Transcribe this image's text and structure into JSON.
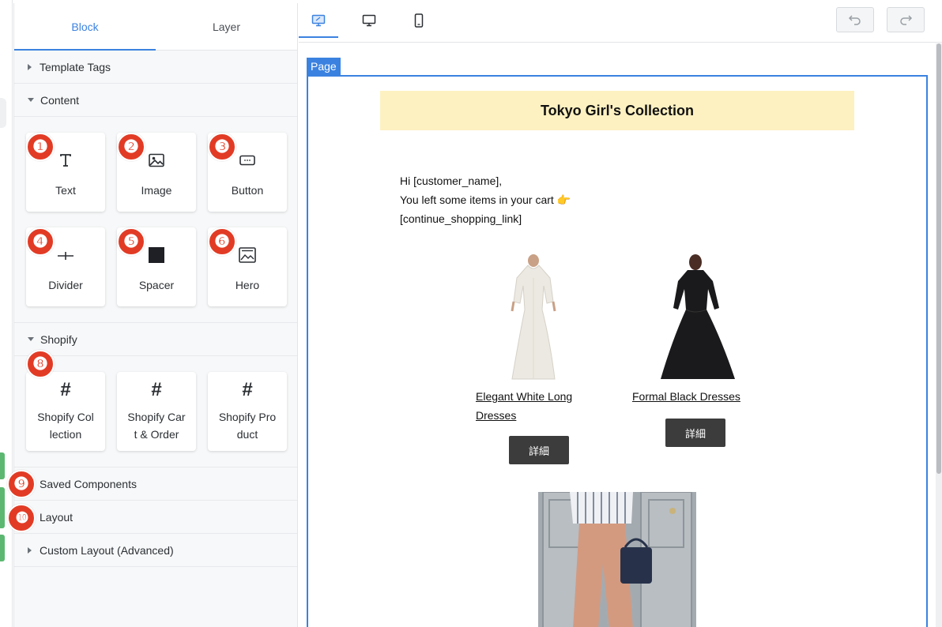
{
  "panel": {
    "tabs": [
      {
        "label": "Block",
        "active": true
      },
      {
        "label": "Layer",
        "active": false
      }
    ],
    "sections": {
      "template_tags": "Template Tags",
      "content": "Content",
      "shopify": "Shopify",
      "saved": "Saved Components",
      "layout": "Layout",
      "custom_layout": "Custom Layout (Advanced)"
    },
    "content_blocks": [
      {
        "label": "Text",
        "icon": "text-icon",
        "badge": "❶"
      },
      {
        "label": "Image",
        "icon": "image-icon",
        "badge": "❷"
      },
      {
        "label": "Button",
        "icon": "button-icon",
        "badge": "❸"
      },
      {
        "label": "Divider",
        "icon": "divider-icon",
        "badge": "❹"
      },
      {
        "label": "Spacer",
        "icon": "spacer-icon",
        "badge": "❺"
      },
      {
        "label": "Hero",
        "icon": "hero-icon",
        "badge": "❻"
      }
    ],
    "shopify_blocks": [
      {
        "label_line1": "Shopify Col",
        "label_line2": "lection",
        "icon": "hash-icon"
      },
      {
        "label_line1": "Shopify Car",
        "label_line2": "t & Order",
        "icon": "hash-icon"
      },
      {
        "label_line1": "Shopify Pro",
        "label_line2": "duct",
        "icon": "hash-icon"
      }
    ],
    "shopify_badge": "❽",
    "saved_badge": "❾",
    "layout_badge": "❿"
  },
  "toolbar": {
    "views": [
      "desktop-edit-icon",
      "desktop-icon",
      "mobile-icon"
    ],
    "active_view": 0
  },
  "canvas": {
    "page_tag": "Page",
    "banner_title": "Tokyo Girl's Collection",
    "greeting_line1": "Hi [customer_name],",
    "greeting_line2": "You left some items in your cart 👉",
    "greeting_line3": "[continue_shopping_link]",
    "products": [
      {
        "title_line1": "Elegant White Long",
        "title_line2": "Dresses",
        "button": "詳細"
      },
      {
        "title_line1": "Formal Black Dresses",
        "title_line2": "",
        "button": "詳細"
      }
    ]
  },
  "colors": {
    "accent": "#3b82e0",
    "badge": "#e23b25",
    "banner": "#fdf1c1",
    "button_dark": "#3c3c3c"
  }
}
